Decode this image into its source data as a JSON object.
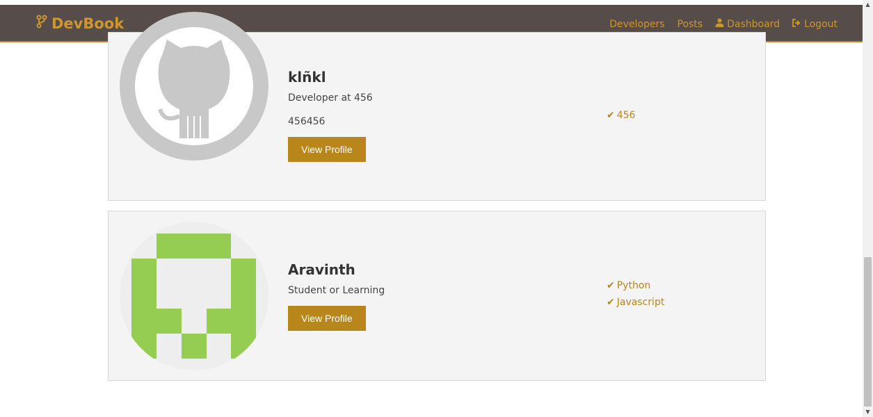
{
  "navbar": {
    "brand": "DevBook",
    "links": {
      "developers": "Developers",
      "posts": "Posts",
      "dashboard": "Dashboard",
      "logout": "Logout"
    },
    "accent": "#cf962c",
    "background": "#564d4a"
  },
  "profiles": [
    {
      "name": "klñkl",
      "subtitle": "Developer at 456",
      "location": "456456",
      "button": "View Profile",
      "avatar": "github-octocat-icon",
      "skills": [
        "456"
      ]
    },
    {
      "name": "Aravinth",
      "subtitle": "Student or Learning",
      "button": "View Profile",
      "avatar": "identicon",
      "skills": [
        "Python",
        "Javascript"
      ]
    }
  ],
  "colors": {
    "button": "#b8861b",
    "card_bg": "#f4f4f4",
    "identicon": "#95cd52"
  }
}
